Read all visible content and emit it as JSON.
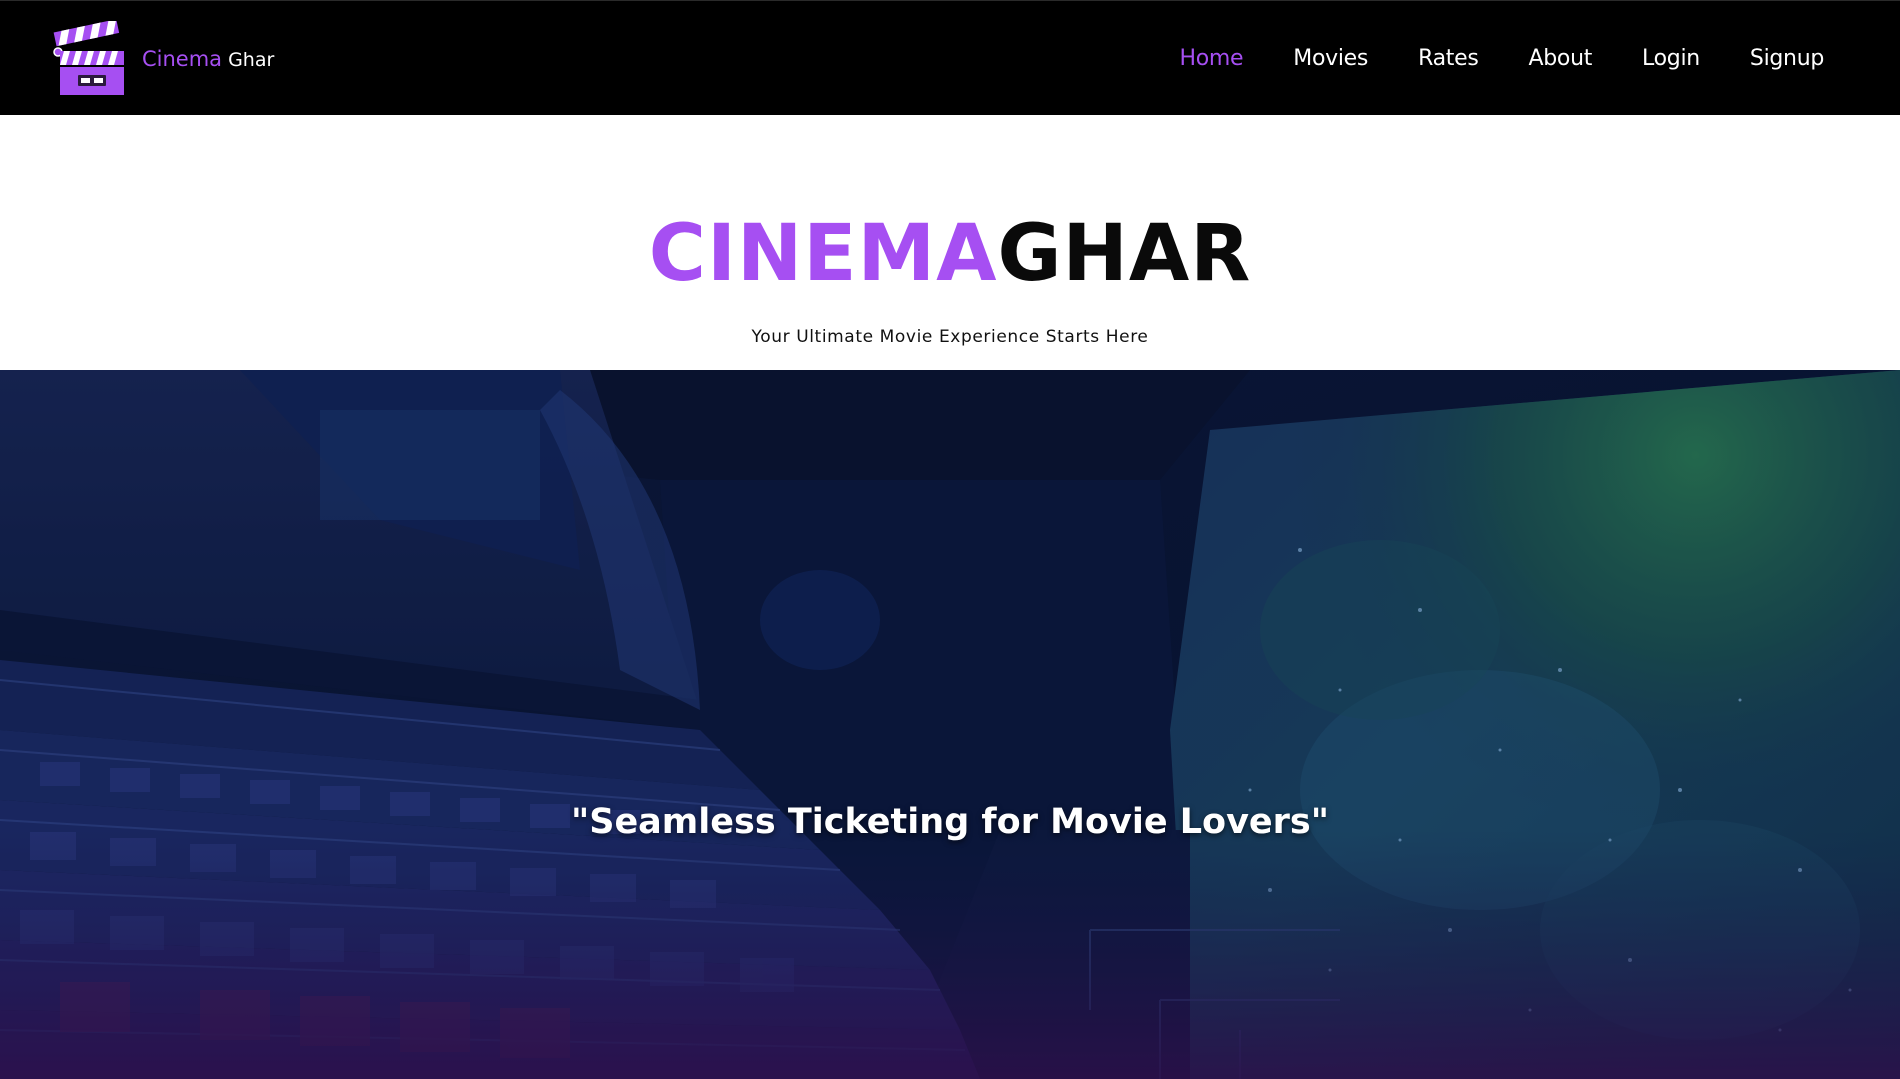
{
  "brand": {
    "name_accent": "Cinema",
    "name_rest": "Ghar",
    "logo_icon": "clapperboard-icon"
  },
  "nav": {
    "items": [
      {
        "label": "Home",
        "active": true
      },
      {
        "label": "Movies",
        "active": false
      },
      {
        "label": "Rates",
        "active": false
      },
      {
        "label": "About",
        "active": false
      },
      {
        "label": "Login",
        "active": false
      },
      {
        "label": "Signup",
        "active": false
      }
    ]
  },
  "header": {
    "title_accent": "CINEMA",
    "title_rest": "GHAR",
    "tagline": "Your Ultimate Movie Experience Starts Here"
  },
  "hero": {
    "quote": "\"Seamless Ticketing for Movie Lovers\""
  },
  "colors": {
    "accent": "#a64ff2",
    "navbar_bg": "#000000",
    "page_bg": "#ffffff"
  }
}
